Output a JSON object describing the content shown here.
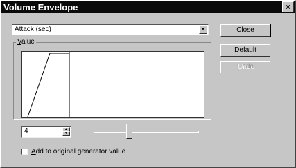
{
  "window": {
    "title": "Volume Envelope",
    "close_glyph": "×"
  },
  "parameter_select": {
    "selected": "Attack (sec)",
    "arrow": "▼"
  },
  "buttons": {
    "close_label": "Close",
    "default_label": "Default",
    "undo_label": "Undo",
    "undo_enabled": false
  },
  "value_group": {
    "label_first_letter": "V",
    "label_rest": "alue"
  },
  "envelope": {
    "attack_fraction": 0.25
  },
  "value_field": {
    "value": "4",
    "up_arrow": "▲",
    "down_arrow": "▼"
  },
  "slider": {
    "position_fraction": 0.33
  },
  "add_option": {
    "checked": false,
    "label_first_letter": "A",
    "label_rest": "dd to original generator value"
  },
  "colors": {
    "title_bar": "#0a0a0a",
    "face": "#c6c6c6"
  }
}
